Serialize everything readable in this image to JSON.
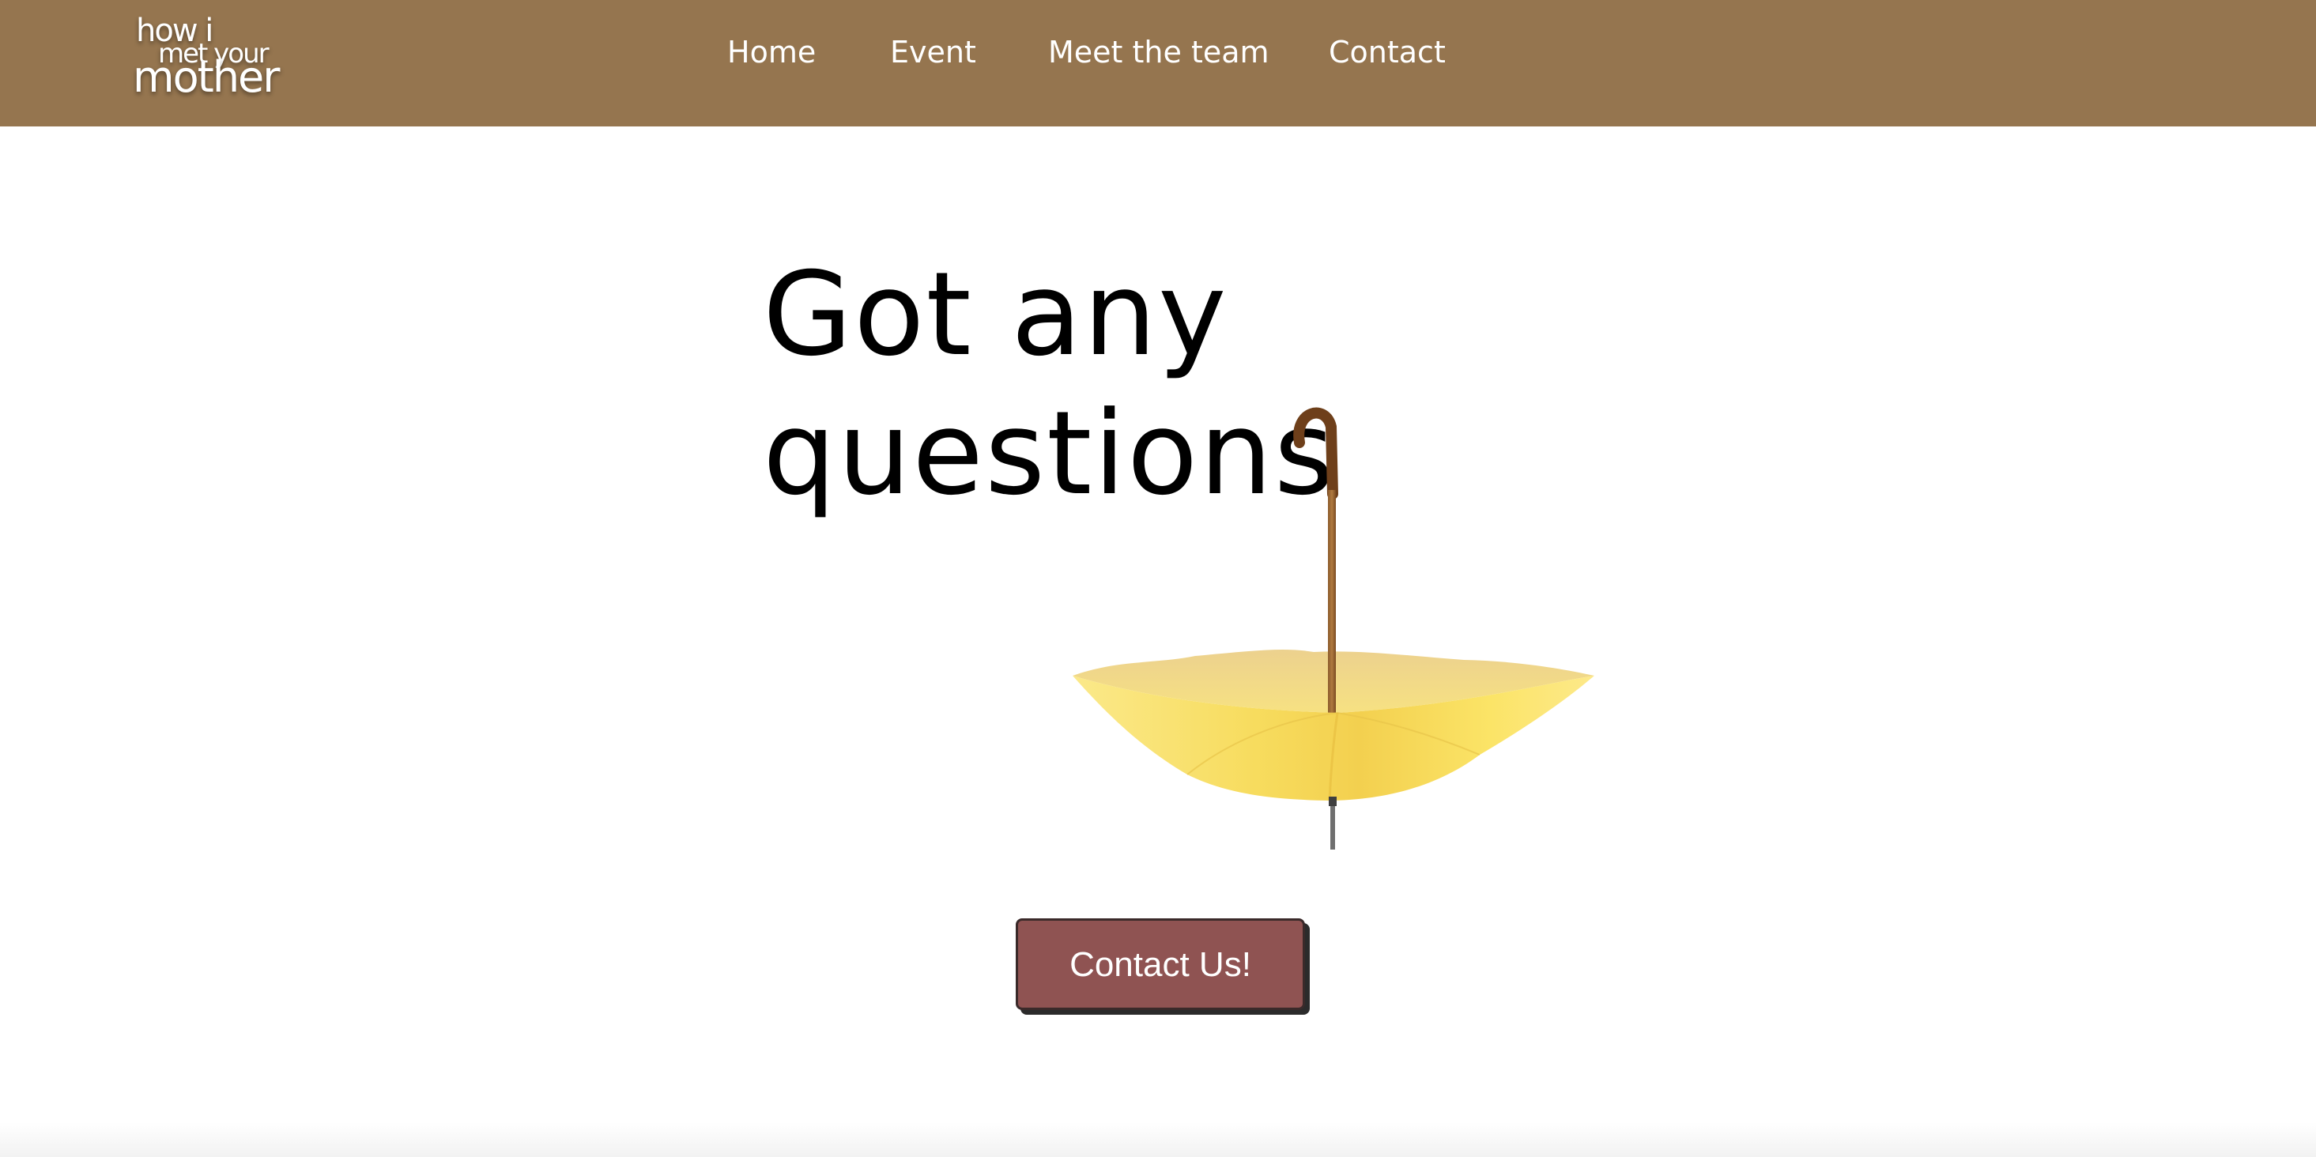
{
  "header": {
    "logo": {
      "line1": "how i",
      "line2": "met your",
      "line3": "mother"
    },
    "nav": [
      {
        "label": "Home"
      },
      {
        "label": "Event"
      },
      {
        "label": "Meet the team"
      },
      {
        "label": "Contact"
      }
    ],
    "background_color": "#95754f"
  },
  "hero": {
    "title_line1": "Got any",
    "title_line2": "questions",
    "illustration": "yellow-umbrella-icon",
    "cta_label": "Contact Us!",
    "cta_color": "#8f5352"
  }
}
